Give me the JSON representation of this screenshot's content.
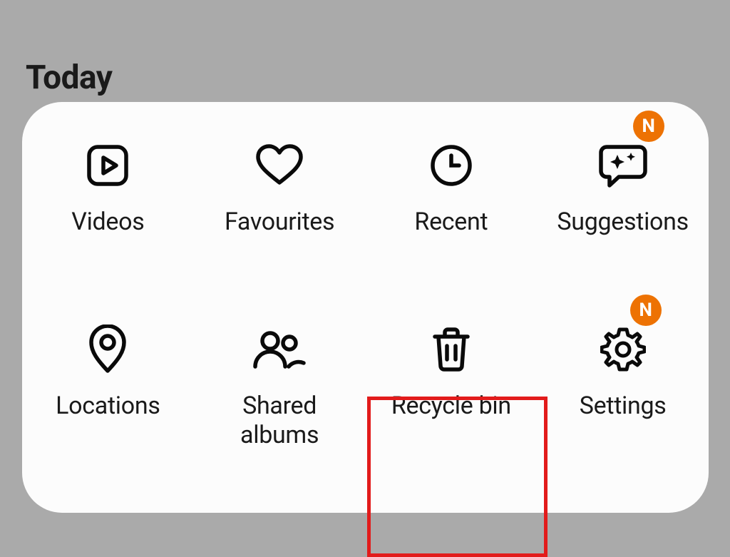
{
  "header": {
    "title": "Today"
  },
  "colors": {
    "accent": "#ed7203",
    "highlight": "#e21b1b"
  },
  "badge_text": "N",
  "menu": {
    "items": [
      {
        "label": "Videos"
      },
      {
        "label": "Favourites"
      },
      {
        "label": "Recent"
      },
      {
        "label": "Suggestions",
        "badge": true
      },
      {
        "label": "Locations"
      },
      {
        "label": "Shared\nalbums"
      },
      {
        "label": "Recycle bin",
        "highlighted": true
      },
      {
        "label": "Settings",
        "badge": true
      }
    ]
  }
}
